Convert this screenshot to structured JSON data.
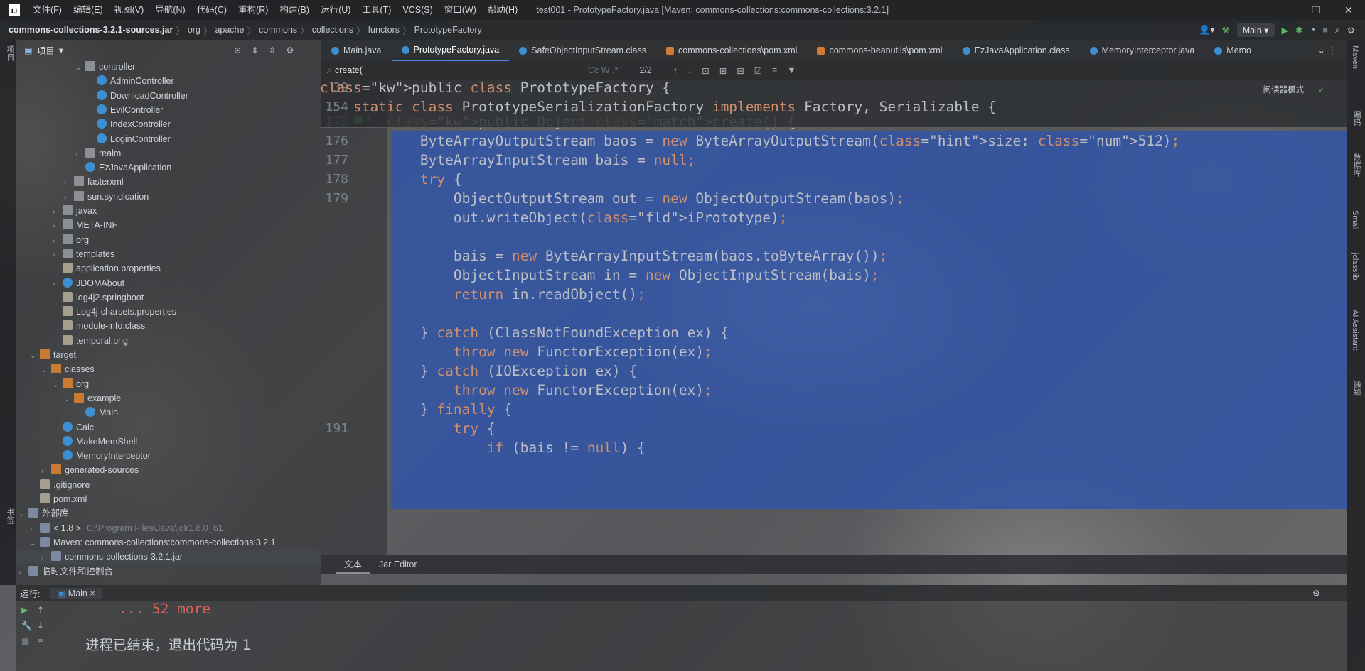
{
  "window": {
    "menu": [
      "文件(F)",
      "编辑(E)",
      "视图(V)",
      "导航(N)",
      "代码(C)",
      "重构(R)",
      "构建(B)",
      "运行(U)",
      "工具(T)",
      "VCS(S)",
      "窗口(W)",
      "帮助(H)"
    ],
    "title": "test001 - PrototypeFactory.java [Maven: commons-collections:commons-collections:3.2.1]",
    "controls": {
      "minimize": "—",
      "maximize": "❐",
      "close": "✕"
    }
  },
  "breadcrumb": [
    "commons-collections-3.2.1-sources.jar",
    "org",
    "apache",
    "commons",
    "collections",
    "functors",
    "PrototypeFactory"
  ],
  "toolbar": {
    "run_config": "Main"
  },
  "project": {
    "title": "项目",
    "tree": [
      {
        "label": "controller",
        "depth": 5,
        "type": "folder",
        "expanded": true
      },
      {
        "label": "AdminController",
        "depth": 6,
        "type": "class"
      },
      {
        "label": "DownloadController",
        "depth": 6,
        "type": "class"
      },
      {
        "label": "EvilController",
        "depth": 6,
        "type": "class"
      },
      {
        "label": "IndexController",
        "depth": 6,
        "type": "class"
      },
      {
        "label": "LoginController",
        "depth": 6,
        "type": "class"
      },
      {
        "label": "realm",
        "depth": 5,
        "type": "folder",
        "expanded": false
      },
      {
        "label": "EzJavaApplication",
        "depth": 5,
        "type": "class"
      },
      {
        "label": "fasterxml",
        "depth": 4,
        "type": "folder",
        "expanded": false
      },
      {
        "label": "sun.syndication",
        "depth": 4,
        "type": "folder",
        "expanded": false
      },
      {
        "label": "javax",
        "depth": 3,
        "type": "folder",
        "expanded": false
      },
      {
        "label": "META-INF",
        "depth": 3,
        "type": "folder",
        "expanded": false
      },
      {
        "label": "org",
        "depth": 3,
        "type": "folder",
        "expanded": false
      },
      {
        "label": "templates",
        "depth": 3,
        "type": "folder",
        "expanded": false
      },
      {
        "label": "application.properties",
        "depth": 3,
        "type": "file"
      },
      {
        "label": "JDOMAbout",
        "depth": 3,
        "type": "class",
        "expanded": false
      },
      {
        "label": "log4j2.springboot",
        "depth": 3,
        "type": "file"
      },
      {
        "label": "Log4j-charsets.properties",
        "depth": 3,
        "type": "file"
      },
      {
        "label": "module-info.class",
        "depth": 3,
        "type": "file"
      },
      {
        "label": "temporal.png",
        "depth": 3,
        "type": "file"
      },
      {
        "label": "target",
        "depth": 1,
        "type": "folder-orange",
        "expanded": true
      },
      {
        "label": "classes",
        "depth": 2,
        "type": "folder-orange",
        "expanded": true
      },
      {
        "label": "org",
        "depth": 3,
        "type": "folder-orange",
        "expanded": true
      },
      {
        "label": "example",
        "depth": 4,
        "type": "folder-orange",
        "expanded": true
      },
      {
        "label": "Main",
        "depth": 5,
        "type": "class"
      },
      {
        "label": "Calc",
        "depth": 3,
        "type": "class"
      },
      {
        "label": "MakeMemShell",
        "depth": 3,
        "type": "class"
      },
      {
        "label": "MemoryInterceptor",
        "depth": 3,
        "type": "class"
      },
      {
        "label": "generated-sources",
        "depth": 2,
        "type": "folder-orange",
        "expanded": false
      },
      {
        "label": ".gitignore",
        "depth": 1,
        "type": "file"
      },
      {
        "label": "pom.xml",
        "depth": 1,
        "type": "file"
      },
      {
        "label": "外部库",
        "depth": 0,
        "type": "lib",
        "expanded": true
      },
      {
        "label": "< 1.8 >",
        "extra": "C:\\Program Files\\Java\\jdk1.8.0_61",
        "depth": 1,
        "type": "lib",
        "expanded": false
      },
      {
        "label": "Maven: commons-collections:commons-collections:3.2.1",
        "depth": 1,
        "type": "lib",
        "expanded": true
      },
      {
        "label": "commons-collections-3.2.1.jar",
        "depth": 2,
        "type": "lib",
        "expanded": false,
        "selected": true
      },
      {
        "label": "临时文件和控制台",
        "depth": 0,
        "type": "lib",
        "expanded": false
      }
    ]
  },
  "tabs": [
    {
      "label": "Main.java",
      "icon": "class"
    },
    {
      "label": "PrototypeFactory.java",
      "icon": "class",
      "active": true
    },
    {
      "label": "SafeObjectInputStream.class",
      "icon": "class"
    },
    {
      "label": "commons-collections\\pom.xml",
      "icon": "maven"
    },
    {
      "label": "commons-beanutils\\pom.xml",
      "icon": "maven"
    },
    {
      "label": "EzJavaApplication.class",
      "icon": "class"
    },
    {
      "label": "MemoryInterceptor.java",
      "icon": "class"
    },
    {
      "label": "Memo",
      "icon": "class"
    }
  ],
  "search": {
    "value": "create(",
    "count": "2/2"
  },
  "editor": {
    "reader_mode": "阅读器模式",
    "sticky": [
      {
        "num": "39",
        "code": "public class PrototypeFactory {"
      },
      {
        "num": "154",
        "code": "    static class PrototypeSerializationFactory implements Factory, Serializable {"
      }
    ],
    "lines": [
      {
        "num": "175",
        "code": "        public Object create() {"
      },
      {
        "num": "176",
        "code": "            ByteArrayOutputStream baos = new ByteArrayOutputStream( size: 512);"
      },
      {
        "num": "177",
        "code": "            ByteArrayInputStream bais = null;"
      },
      {
        "num": "178",
        "code": "            try {"
      },
      {
        "num": "179",
        "code": "                ObjectOutputStream out = new ObjectOutputStream(baos);"
      },
      {
        "num": "",
        "code": "                out.writeObject(iPrototype);"
      },
      {
        "num": "",
        "code": ""
      },
      {
        "num": "",
        "code": "                bais = new ByteArrayInputStream(baos.toByteArray());"
      },
      {
        "num": "",
        "code": "                ObjectInputStream in = new ObjectInputStream(bais);"
      },
      {
        "num": "",
        "code": "                return in.readObject();"
      },
      {
        "num": "",
        "code": ""
      },
      {
        "num": "",
        "code": "            } catch (ClassNotFoundException ex) {"
      },
      {
        "num": "",
        "code": "                throw new FunctorException(ex);"
      },
      {
        "num": "",
        "code": "            } catch (IOException ex) {"
      },
      {
        "num": "",
        "code": "                throw new FunctorException(ex);"
      },
      {
        "num": "",
        "code": "            } finally {"
      },
      {
        "num": "191",
        "code": "                try {"
      },
      {
        "num": "",
        "code": "                    if (bais != null) {"
      }
    ]
  },
  "bottom_tabs": [
    "文本",
    "Jar Editor"
  ],
  "run": {
    "label": "运行:",
    "tab": "Main",
    "output": [
      "    ... 52 more",
      "",
      "进程已结束，退出代码为 1"
    ]
  },
  "right_stripe": [
    "Maven",
    "编码",
    "数据库",
    "Smali",
    "jclasslib",
    "AI Assistant",
    "通知"
  ],
  "left_stripe": [
    "项目",
    "书签"
  ],
  "colors": {
    "selection": "#2f54aa",
    "keyword": "#cf8e6d",
    "field": "#c77dbb",
    "number": "#2aacb8",
    "error_text": "#e0625a"
  }
}
